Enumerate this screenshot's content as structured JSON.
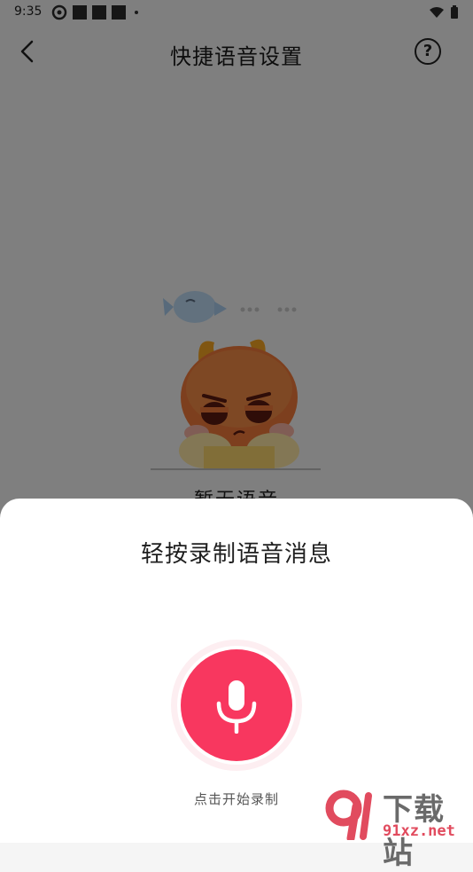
{
  "status_bar": {
    "time": "9:35"
  },
  "nav": {
    "title": "快捷语音设置",
    "help_label": "?"
  },
  "preview": {
    "label": "暂无语音"
  },
  "sheet": {
    "title": "轻按录制语音消息",
    "hint": "点击开始录制"
  },
  "colors": {
    "accent": "#f8375f",
    "overlay": "rgba(0,0,0,0.48)"
  },
  "icons": {
    "back": "chevron-left-icon",
    "help": "question-circle-icon",
    "mic": "microphone-icon",
    "wifi": "wifi-icon",
    "battery": "battery-icon"
  },
  "watermark": {
    "title": "下载站",
    "url": "91xz.net"
  }
}
